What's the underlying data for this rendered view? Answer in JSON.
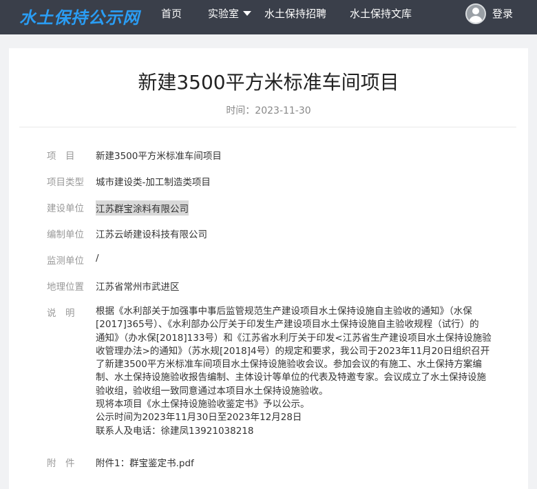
{
  "header": {
    "logo": "水土保持公示网",
    "nav": [
      "首页",
      "实验室",
      "水土保持招聘",
      "水土保持文库"
    ],
    "login": "登录"
  },
  "article": {
    "title": "新建3500平方米标准车间项目",
    "time": "时间：2023-11-30",
    "fields": [
      {
        "label": "项　目",
        "value": "新建3500平方米标准车间项目"
      },
      {
        "label": "项目类型",
        "value": "城市建设类-加工制造类项目"
      },
      {
        "label": "建设单位",
        "value": "江苏群宝涂料有限公司"
      },
      {
        "label": "编制单位",
        "value": "江苏云峤建设科技有限公司"
      },
      {
        "label": "监测单位",
        "value": "/"
      },
      {
        "label": "地理位置",
        "value": "江苏省常州市武进区"
      }
    ],
    "desc_label": "说　明",
    "desc_lines": [
      "根据《水利部关于加强事中事后监管规范生产建设项目水土保持设施自主验收的通知》（水保",
      "[2017]365号）、《水利部办公厅关于印发生产建设项目水土保持设施自主验收规程（试行）的",
      "通知》（办水保[2018]133号）和《江苏省水利厅关于印发<江苏省生产建设项目水土保持设施验",
      "收管理办法>的通知》（苏水规[2018]4号）的规定和要求，我公司于2023年11月20日组织召开",
      "了新建3500平方米标准车间项目水土保持设施验收会议。参加会议的有施工、水土保持方案编",
      "制、水土保持设施验收报告编制、主体设计等单位的代表及特邀专家。会议成立了水土保持设施",
      "验收组，验收组一致同意通过本项目水土保持设施验收。",
      "现将本项目《水土保持设施验收鉴定书》予以公示。",
      "公示时间为2023年11月30日至2023年12月28日",
      "联系人及电话：徐建凤13921038218"
    ],
    "attach_label": "附　件",
    "attach_link": "附件1：群宝鉴定书.pdf"
  }
}
